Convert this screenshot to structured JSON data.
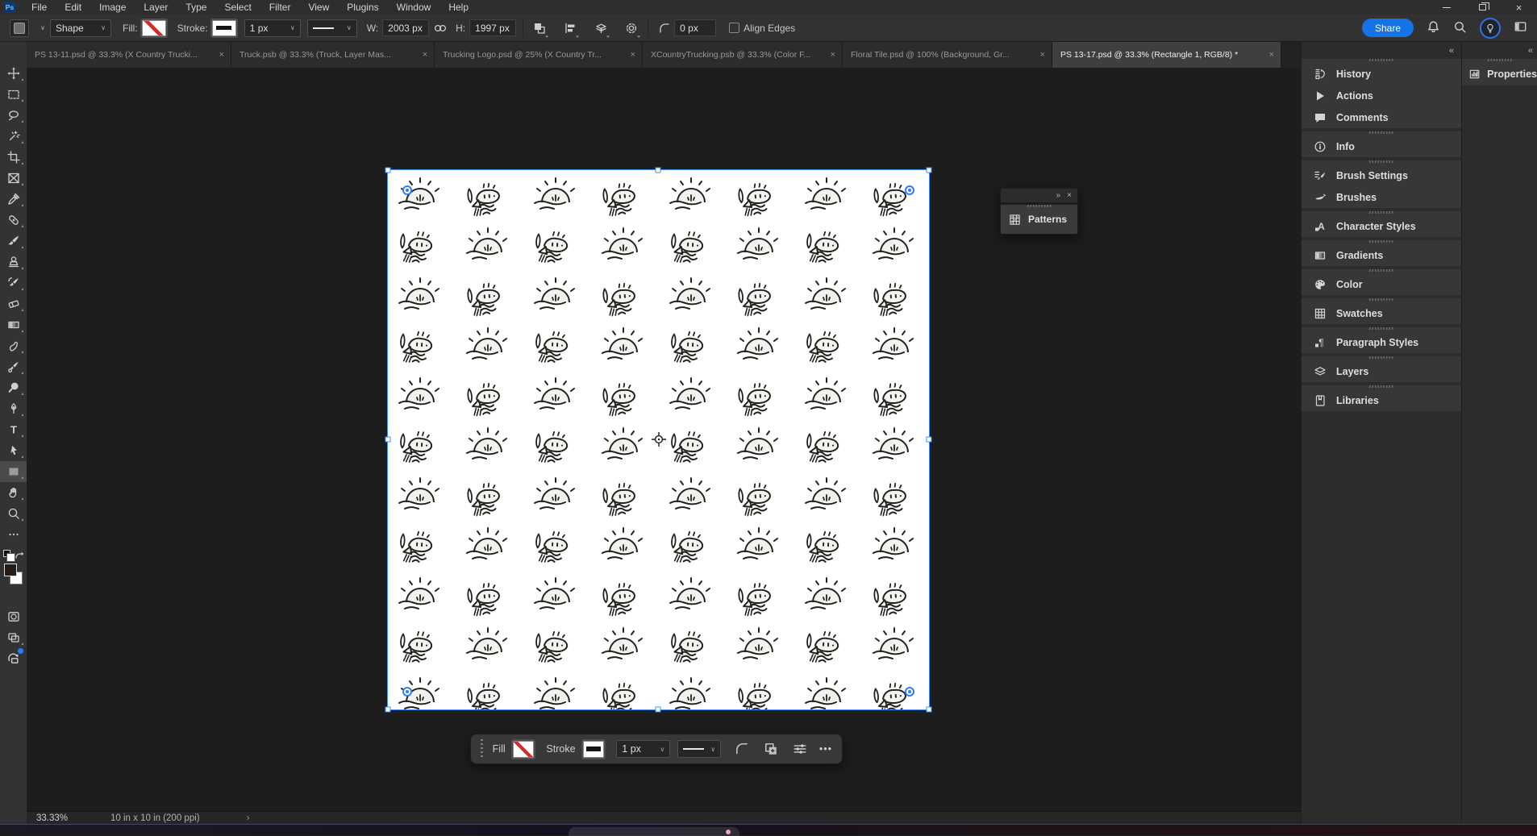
{
  "app": {
    "logo": "Ps"
  },
  "menus": [
    "File",
    "Edit",
    "Image",
    "Layer",
    "Type",
    "Select",
    "Filter",
    "View",
    "Plugins",
    "Window",
    "Help"
  ],
  "ui": {
    "close_glyph": "×",
    "chevron_down": "∨",
    "collapse_left": "«",
    "collapse_right": "»",
    "more_dots": "•••",
    "status_chevron": "›",
    "type_glyph": "T",
    "char_style_glyph": "A",
    "para_style_glyph": "¶"
  },
  "options_bar": {
    "tool_mode": "Shape",
    "fill_label": "Fill:",
    "stroke_label": "Stroke:",
    "stroke_width": "1 px",
    "width_label": "W:",
    "width_value": "2003 px",
    "height_label": "H:",
    "height_value": "1997 px",
    "radius_value": "0 px",
    "align_edges": "Align Edges"
  },
  "header_actions": {
    "share": "Share"
  },
  "tabs": [
    {
      "label": "PS 13-11.psd @ 33.3% (X Country Trucki...",
      "active": false
    },
    {
      "label": "Truck.psb @ 33.3% (Truck, Layer Mas...",
      "active": false
    },
    {
      "label": "Trucking Logo.psd @ 25% (X Country Tr...",
      "active": false
    },
    {
      "label": "XCountryTrucking.psb @ 33.3% (Color F...",
      "active": false
    },
    {
      "label": "Floral Tile.psd @ 100% (Background, Gr...",
      "active": false
    },
    {
      "label": "PS 13-17.psd @ 33.3% (Rectangle 1, RGB/8) *",
      "active": true
    }
  ],
  "toolbar_tools": [
    "move-tool",
    "rectangular-marquee-tool",
    "lasso-tool",
    "magic-wand-tool",
    "crop-tool",
    "frame-tool",
    "eyedropper-tool",
    "spot-healing-brush-tool",
    "brush-tool",
    "clone-stamp-tool",
    "history-brush-tool",
    "eraser-tool",
    "gradient-tool",
    "smudge-tool",
    "mixer-brush-tool",
    "dodge-tool",
    "pen-tool",
    "type-tool",
    "path-selection-tool",
    "rectangle-tool",
    "hand-tool",
    "zoom-tool",
    "edit-toolbar"
  ],
  "patterns_panel": {
    "title": "Patterns"
  },
  "context_taskbar": {
    "fill_label": "Fill",
    "stroke_label": "Stroke",
    "stroke_width": "1 px"
  },
  "right_dock": {
    "groups": [
      {
        "items": [
          {
            "icon": "history-icon",
            "label": "History"
          },
          {
            "icon": "actions-icon",
            "label": "Actions"
          },
          {
            "icon": "comments-icon",
            "label": "Comments"
          }
        ]
      },
      {
        "items": [
          {
            "icon": "info-icon",
            "label": "Info"
          }
        ]
      },
      {
        "items": [
          {
            "icon": "brush-settings-icon",
            "label": "Brush Settings"
          },
          {
            "icon": "brushes-icon",
            "label": "Brushes"
          }
        ]
      },
      {
        "items": [
          {
            "icon": "character-styles-icon",
            "label": "Character Styles"
          }
        ]
      },
      {
        "items": [
          {
            "icon": "gradients-icon",
            "label": "Gradients"
          }
        ]
      },
      {
        "items": [
          {
            "icon": "color-icon",
            "label": "Color"
          }
        ]
      },
      {
        "items": [
          {
            "icon": "swatches-icon",
            "label": "Swatches"
          }
        ]
      },
      {
        "items": [
          {
            "icon": "paragraph-styles-icon",
            "label": "Paragraph Styles"
          }
        ]
      },
      {
        "items": [
          {
            "icon": "layers-icon",
            "label": "Layers"
          }
        ]
      },
      {
        "items": [
          {
            "icon": "libraries-icon",
            "label": "Libraries"
          }
        ]
      }
    ]
  },
  "properties_panel": {
    "title": "Properties"
  },
  "statusbar": {
    "zoom": "33.33%",
    "doc_info": "10 in x 10 in (200 ppi)"
  },
  "canvas": {
    "pattern_motifs": [
      "sun-doodle",
      "fish-doodle"
    ]
  },
  "colors": {
    "accent_blue": "#1473e6",
    "selection_blue": "#3e8df5",
    "foreground_swatch": "#241c15",
    "background_swatch": "#ffffff",
    "no_fill_slash": "#d42a2a"
  }
}
